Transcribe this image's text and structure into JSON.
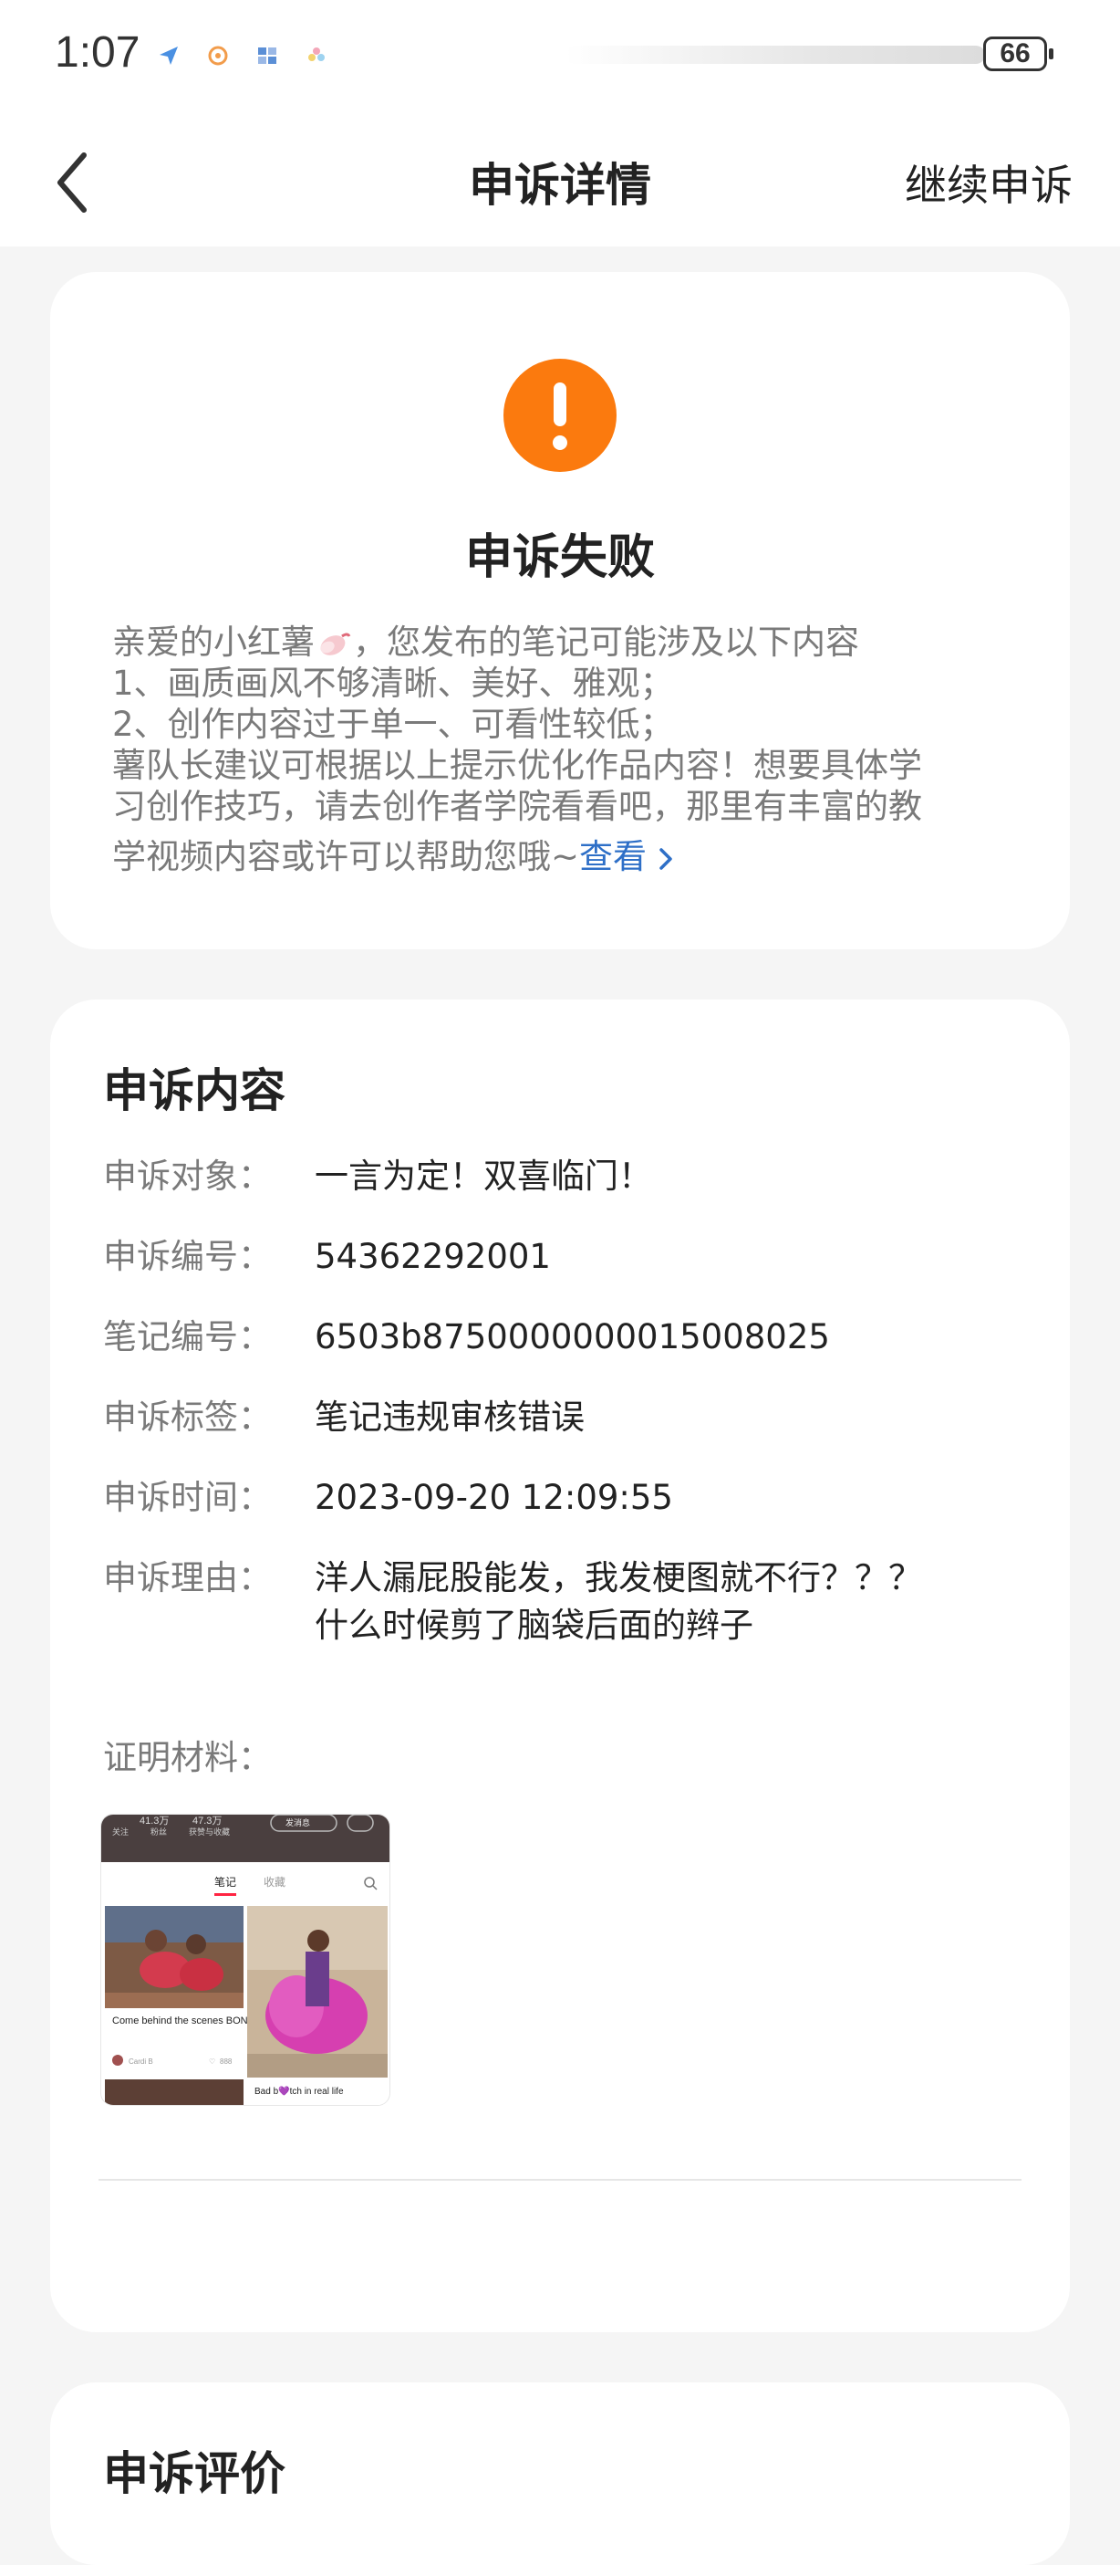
{
  "status_bar": {
    "time": "1:07",
    "battery": "66"
  },
  "nav": {
    "title": "申诉详情",
    "continue_label": "继续申诉"
  },
  "status_card": {
    "title": "申诉失败",
    "message_lines": [
      "亲爱的小红薯",
      "，您发布的笔记可能涉及以下内容",
      "1、画质画风不够清晰、美好、雅观；",
      "2、创作内容过于单一、可看性较低；",
      "薯队长建议可根据以上提示优化作品内容！想要具体学",
      "习创作技巧，请去创作者学院看看吧，那里有丰富的教",
      "学视频内容或许可以帮助您哦~"
    ],
    "link_label": "查看",
    "accent_color": "#fb7a0e",
    "link_color": "#2e6fc7"
  },
  "content_card": {
    "title": "申诉内容",
    "rows": [
      {
        "label": "申诉对象：",
        "value": "一言为定！双喜临门！"
      },
      {
        "label": "申诉编号：",
        "value": "54362292001"
      },
      {
        "label": "笔记编号：",
        "value": "6503b8750000000015008025"
      },
      {
        "label": "申诉标签：",
        "value": "笔记违规审核错误"
      },
      {
        "label": "申诉时间：",
        "value": "2023-09-20 12:09:55"
      },
      {
        "label": "申诉理由：",
        "value": "洋人漏屁股能发，我发梗图就不行？？？\n什么时候剪了脑袋后面的辫子"
      }
    ],
    "evidence_label": "证明材料：",
    "thumbnail": {
      "stats": [
        "41.3万",
        "47.3万"
      ],
      "stat_labels": [
        "关注",
        "粉丝",
        "获赞与收藏"
      ],
      "send_message": "发消息",
      "tabs": [
        "笔记",
        "收藏"
      ],
      "post1_caption": "Come behind the scenes BONGOS",
      "post1_author": "Cardi B",
      "post1_likes": "888",
      "post2_caption": "Bad b💜tch in real life"
    }
  },
  "evaluation_card": {
    "title": "申诉评价"
  }
}
